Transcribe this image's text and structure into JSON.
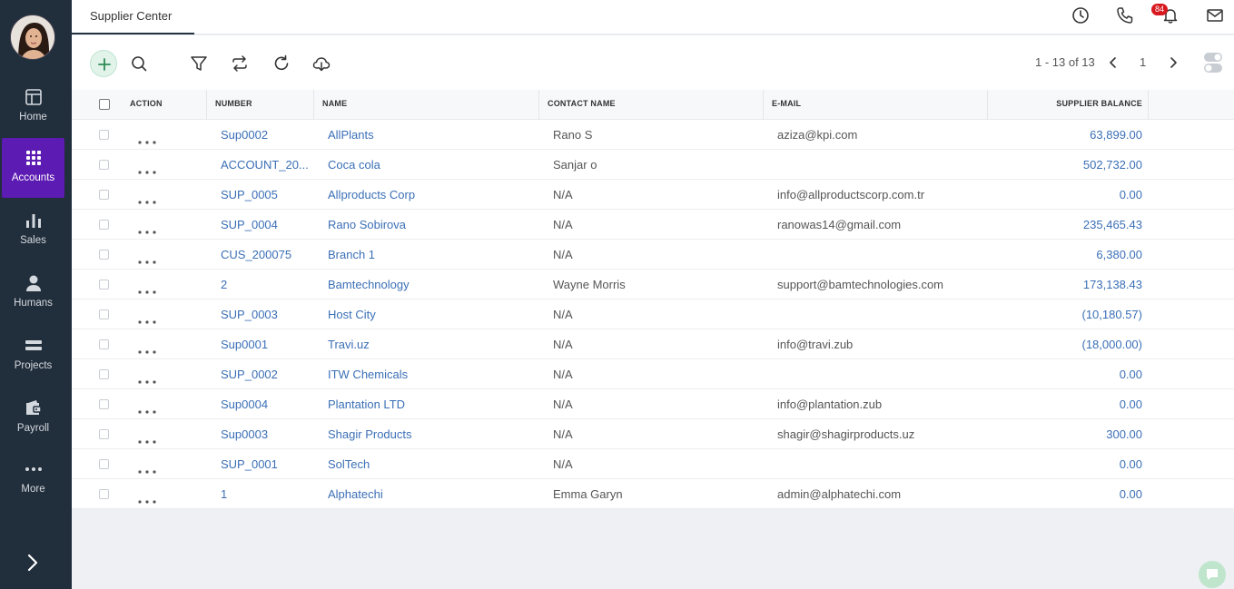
{
  "sidebar": {
    "items": [
      {
        "label": "Home",
        "icon": "home-icon"
      },
      {
        "label": "Accounts",
        "icon": "grid-icon",
        "active": true
      },
      {
        "label": "Sales",
        "icon": "bar-chart-icon"
      },
      {
        "label": "Humans",
        "icon": "person-icon"
      },
      {
        "label": "Projects",
        "icon": "projects-icon"
      },
      {
        "label": "Payroll",
        "icon": "wallet-icon"
      },
      {
        "label": "More",
        "icon": "more-icon"
      }
    ]
  },
  "header": {
    "tab_label": "Supplier Center",
    "notification_count": "84"
  },
  "pager": {
    "range": "1 - 13 of 13",
    "page": "1"
  },
  "table": {
    "columns": [
      "ACTION",
      "NUMBER",
      "NAME",
      "CONTACT NAME",
      "E-MAIL",
      "SUPPLIER BALANCE"
    ],
    "rows": [
      {
        "number": "Sup0002",
        "name": "AllPlants",
        "contact": "Rano S",
        "email": "aziza@kpi.com",
        "balance": "63,899.00"
      },
      {
        "number": "ACCOUNT_20...",
        "name": "Coca cola",
        "contact": "Sanjar o",
        "email": "",
        "balance": "502,732.00"
      },
      {
        "number": "SUP_0005",
        "name": "Allproducts Corp",
        "contact": "N/A",
        "email": "info@allproductscorp.com.tr",
        "balance": "0.00"
      },
      {
        "number": "SUP_0004",
        "name": "Rano Sobirova",
        "contact": "N/A",
        "email": "ranowas14@gmail.com",
        "balance": "235,465.43"
      },
      {
        "number": "CUS_200075",
        "name": "Branch 1",
        "contact": "N/A",
        "email": "",
        "balance": "6,380.00"
      },
      {
        "number": "2",
        "name": "Bamtechnology",
        "contact": "Wayne Morris",
        "email": "support@bamtechnologies.com",
        "balance": "173,138.43"
      },
      {
        "number": "SUP_0003",
        "name": "Host City",
        "contact": "N/A",
        "email": "",
        "balance": "(10,180.57)"
      },
      {
        "number": "Sup0001",
        "name": "Travi.uz",
        "contact": "N/A",
        "email": "info@travi.zub",
        "balance": "(18,000.00)"
      },
      {
        "number": "SUP_0002",
        "name": "ITW Chemicals",
        "contact": "N/A",
        "email": "",
        "balance": "0.00"
      },
      {
        "number": "Sup0004",
        "name": "Plantation LTD",
        "contact": "N/A",
        "email": "info@plantation.zub",
        "balance": "0.00"
      },
      {
        "number": "Sup0003",
        "name": "Shagir Products",
        "contact": "N/A",
        "email": "shagir@shagirproducts.uz",
        "balance": "300.00"
      },
      {
        "number": "SUP_0001",
        "name": "SolTech",
        "contact": "N/A",
        "email": "",
        "balance": "0.00"
      },
      {
        "number": "1",
        "name": "Alphatechi",
        "contact": "Emma Garyn",
        "email": "admin@alphatechi.com",
        "balance": "0.00"
      }
    ]
  },
  "colors": {
    "sidebar_bg": "#212e3b",
    "active_nav": "#5c1bb2",
    "link": "#3b6fb6",
    "badge": "#d7191f"
  }
}
